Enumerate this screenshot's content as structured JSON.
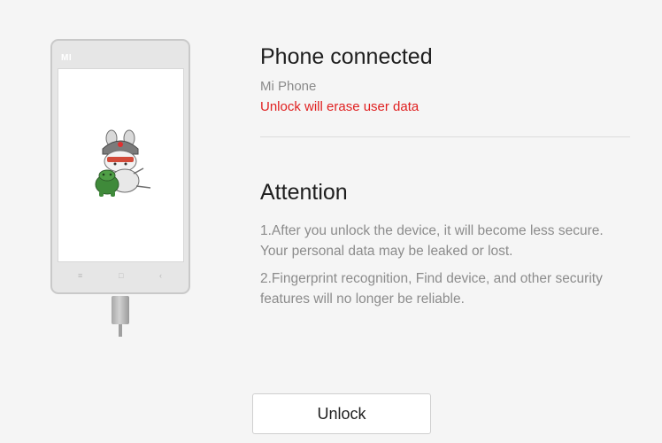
{
  "phone": {
    "brand": "MI",
    "nav_menu_icon": "≡",
    "nav_home_icon": "□",
    "nav_back_icon": "‹"
  },
  "status": {
    "title": "Phone connected",
    "device_name": "Mi Phone",
    "warning": "Unlock will erase user data",
    "warning_color": "#e02020"
  },
  "attention": {
    "title": "Attention",
    "notes": [
      "1.After you unlock the device, it will become less secure. Your personal data may be leaked or lost.",
      "2.Fingerprint recognition, Find device, and other security features will no longer be reliable."
    ]
  },
  "actions": {
    "unlock_label": "Unlock"
  }
}
